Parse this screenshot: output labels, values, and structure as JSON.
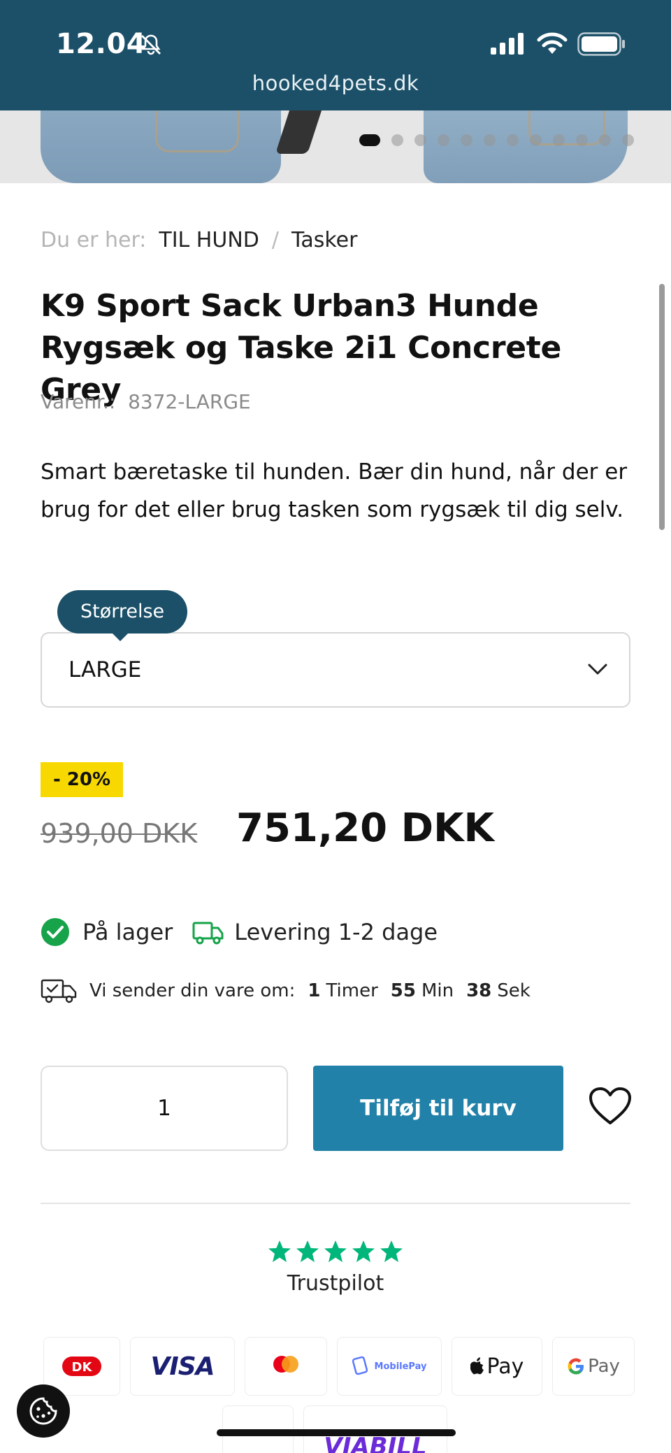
{
  "status_bar": {
    "time": "12.04",
    "url": "hooked4pets.dk"
  },
  "carousel": {
    "slide_count": 12,
    "active_index": 0
  },
  "breadcrumb": {
    "prefix": "Du er her:",
    "items": [
      "TIL HUND",
      "Tasker"
    ],
    "separator": "/"
  },
  "product": {
    "title": "K9 Sport Sack Urban3 Hunde Rygsæk og Taske 2i1 Concrete Grey",
    "sku_label": "Varenr.:",
    "sku": "8372-LARGE",
    "description": "Smart bæretaske til hunden. Bær din hund, når der er brug for det eller brug tasken som rygsæk til dig selv."
  },
  "size_select": {
    "label": "Størrelse",
    "value": "LARGE"
  },
  "pricing": {
    "discount_badge": "- 20%",
    "old_price": "939,00  DKK",
    "new_price": "751,20 DKK"
  },
  "stock": {
    "in_stock": "På lager",
    "delivery": "Levering 1-2 dage"
  },
  "shipping_countdown": {
    "label": "Vi sender din vare om:",
    "hours": "1",
    "hours_unit": "Timer",
    "minutes": "55",
    "minutes_unit": "Min",
    "seconds": "38",
    "seconds_unit": "Sek"
  },
  "cart": {
    "quantity": "1",
    "add_label": "Tilføj til kurv"
  },
  "reviews": {
    "provider": "Trustpilot",
    "stars": 5
  },
  "payments": {
    "visa": "VISA",
    "mobilepay": "MobilePay",
    "applepay": "Pay",
    "googlepay": "Pay",
    "viabill": "VIABILL"
  },
  "colors": {
    "header_bg": "#1b5068",
    "accent_button": "#2181a8",
    "discount_badge": "#f7d800",
    "in_stock_green": "#16a34a",
    "trustpilot_green": "#00b67a"
  }
}
